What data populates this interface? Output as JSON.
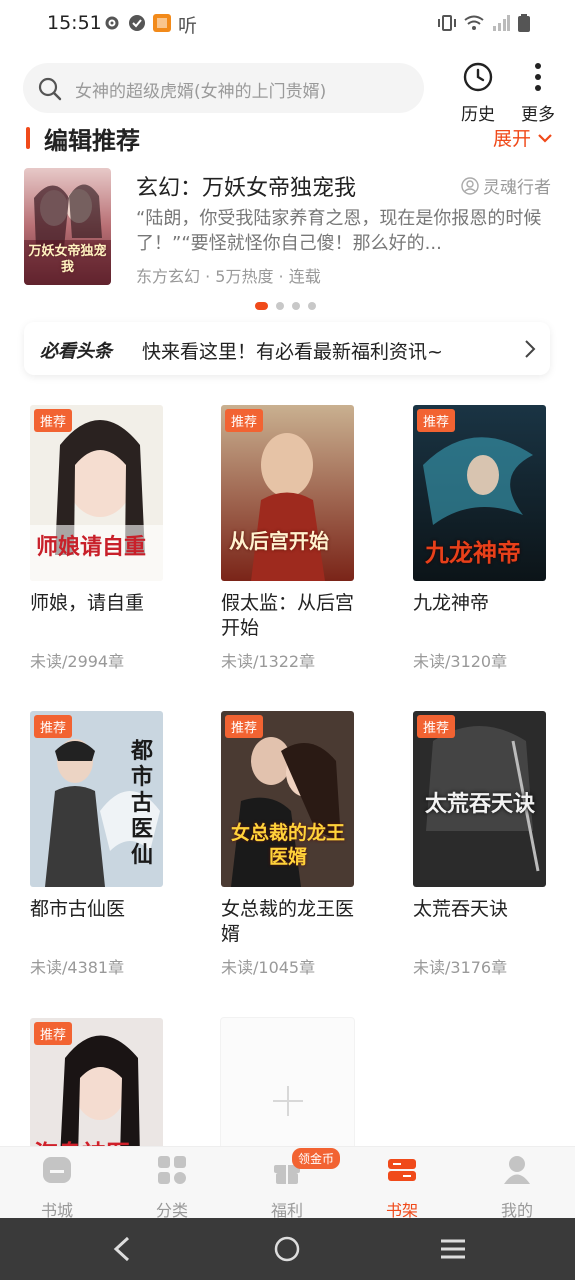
{
  "status_bar": {
    "time": "15:51",
    "app_label": "听"
  },
  "search": {
    "placeholder": "女神的超级虎婿(女神的上门贵婿)"
  },
  "top_actions": {
    "history": "历史",
    "more": "更多"
  },
  "editor_pick": {
    "title": "编辑推荐",
    "expand_label": "展开",
    "featured": {
      "title": "玄幻：万妖女帝独宠我",
      "author": "灵魂行者",
      "description": "“陆朗，你受我陆家养育之恩，现在是你报恩的时候了！”“要怪就怪你自己傻！那么好的...",
      "meta": "东方玄幻 · 5万热度 · 连载",
      "cover_text": "万妖女帝独宠我"
    },
    "carousel_pages": 4,
    "carousel_active": 1
  },
  "news": {
    "logo": "必看头条",
    "message": "快来看这里！有必看最新福利资讯~"
  },
  "shelf": {
    "badge_label": "推荐",
    "books": [
      {
        "title": "师娘，请自重",
        "progress": "未读/2994章",
        "cover_text": "师娘请自重"
      },
      {
        "title": "假太监：从后宫开始",
        "progress": "未读/1322章",
        "cover_text": "从后宫开始"
      },
      {
        "title": "九龙神帝",
        "progress": "未读/3120章",
        "cover_text": "九龙神帝"
      },
      {
        "title": "都市古仙医",
        "progress": "未读/4381章",
        "cover_text": "都市古医仙"
      },
      {
        "title": "女总裁的龙王医婿",
        "progress": "未读/1045章",
        "cover_text": "女总裁的龙王医婿"
      },
      {
        "title": "太荒吞天诀",
        "progress": "未读/3176章",
        "cover_text": "太荒吞天诀"
      },
      {
        "title": "",
        "progress": "",
        "cover_text": "海岛神医"
      }
    ]
  },
  "bottom_nav": {
    "items": [
      {
        "label": "书城"
      },
      {
        "label": "分类"
      },
      {
        "label": "福利"
      },
      {
        "label": "书架"
      },
      {
        "label": "我的"
      }
    ],
    "active_index": 3,
    "coin_badge": "领金币"
  },
  "colors": {
    "accent": "#f04a1a",
    "badge": "#f26332"
  }
}
